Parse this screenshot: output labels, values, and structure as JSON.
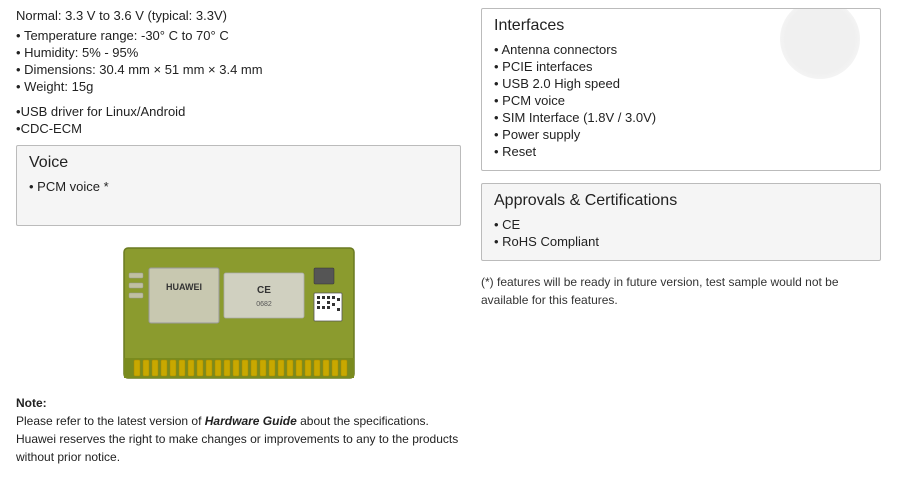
{
  "top_specs": {
    "voltage": "Normal: 3.3 V to 3.6 V (typical: 3.3V)",
    "items": [
      "Temperature range:   -30°  C to 70°  C",
      "Humidity:  5% -  95%",
      "Dimensions:  30.4 mm × 51 mm × 3.4 mm",
      "Weight:   15g"
    ]
  },
  "drivers": {
    "items": [
      "USB driver for Linux/Android",
      "CDC-ECM"
    ]
  },
  "voice": {
    "title": "Voice",
    "items": [
      "PCM voice *"
    ]
  },
  "interfaces": {
    "title": "Interfaces",
    "items": [
      "Antenna  connectors",
      "PCIE interfaces",
      "USB 2.0 High speed",
      "PCM voice",
      "SIM Interface (1.8V / 3.0V)",
      "Power supply",
      "Reset"
    ]
  },
  "approvals": {
    "title": "Approvals & Certifications",
    "items": [
      "CE",
      "RoHS Compliant"
    ]
  },
  "footnote": {
    "asterisk": "(*) features will be ready in future version, test sample would not be available for this features."
  },
  "note": {
    "label": "Note:",
    "text": "Please refer to the latest version of ",
    "italic": "Hardware Guide",
    "text2": " about the specifications. Huawei reserves the right to make changes or improvements to any to the products without prior notice."
  },
  "pcb": {
    "alt": "Huawei CE0682 PCB module"
  }
}
